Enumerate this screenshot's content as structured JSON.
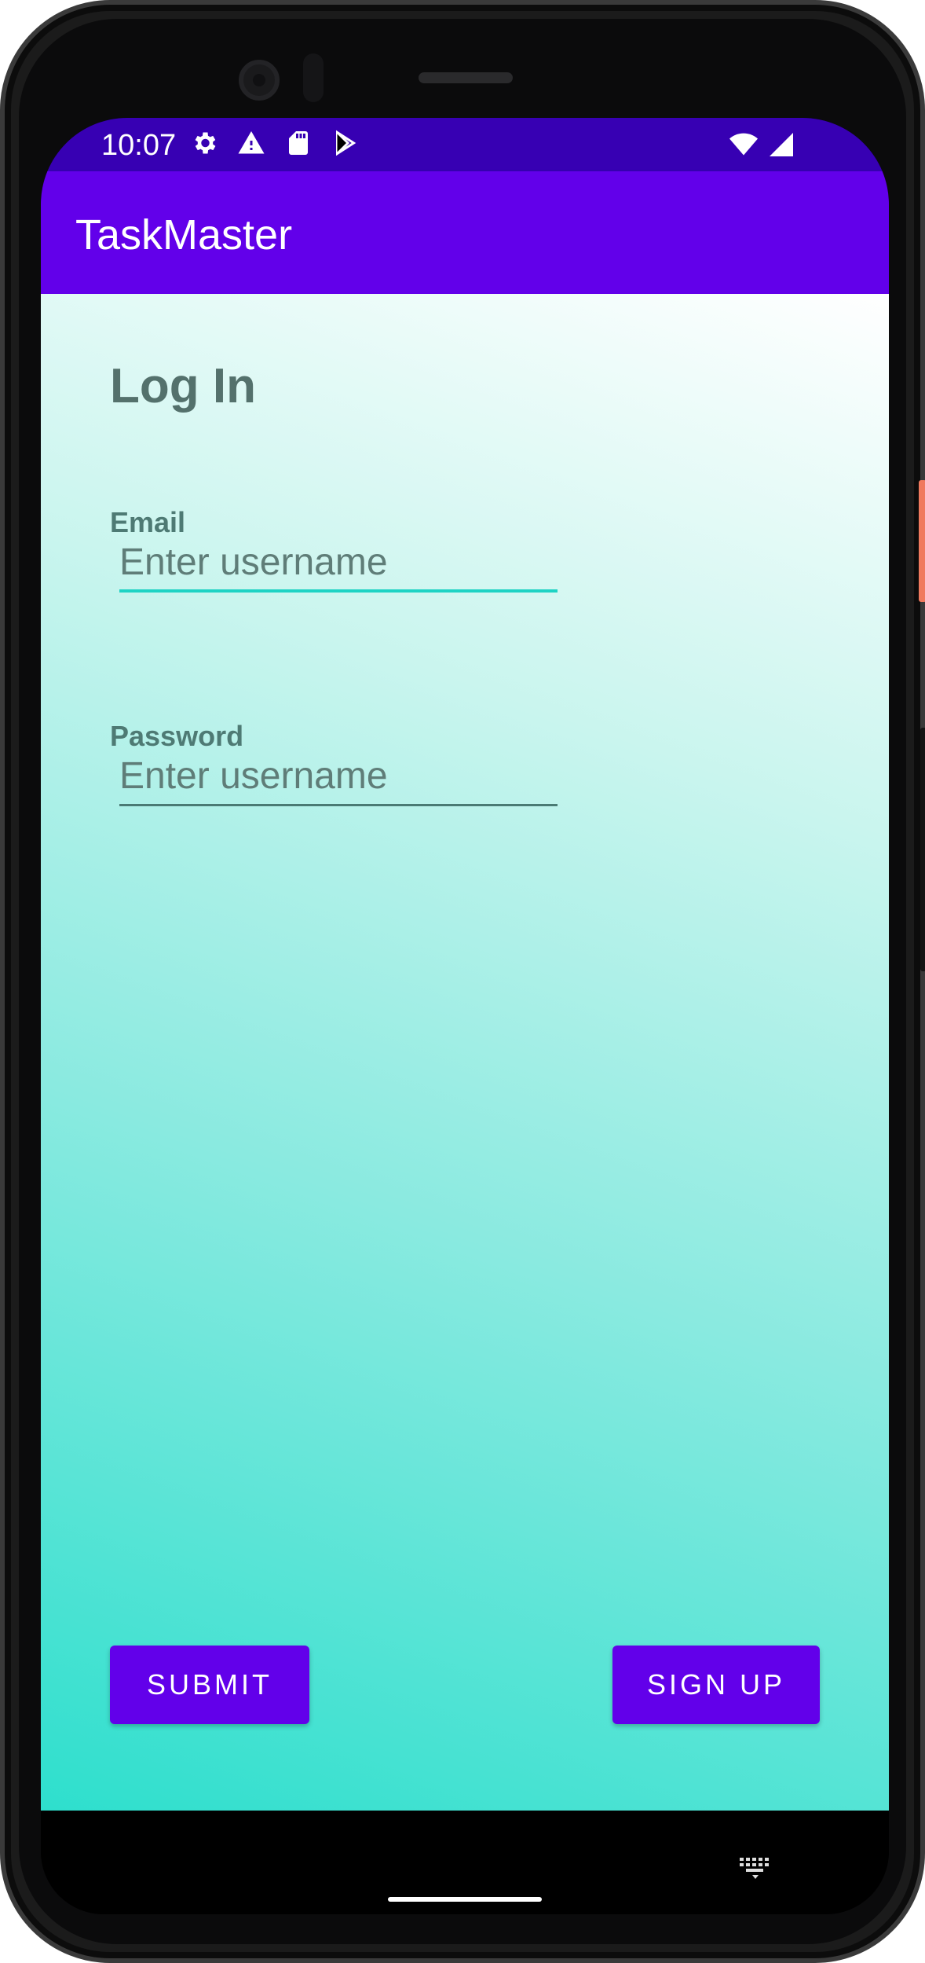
{
  "status_bar": {
    "time": "10:07",
    "left_icons": [
      "settings-icon",
      "warning-icon",
      "sd-card-icon",
      "play-store-icon"
    ],
    "right_icons": [
      "wifi-icon",
      "signal-icon"
    ]
  },
  "app_bar": {
    "title": "TaskMaster"
  },
  "login": {
    "heading": "Log In",
    "email_label": "Email",
    "email_placeholder": "Enter username",
    "password_label": "Password",
    "password_placeholder": "Enter username",
    "submit_label": "SUBMIT",
    "signup_label": "SIGN UP"
  },
  "colors": {
    "status_bar": "#3700b3",
    "app_bar": "#6200ea",
    "button": "#6200ea",
    "focus_underline": "#1ed3c4"
  },
  "nav_bar": {
    "icons": [
      "keyboard-icon",
      "home-gesture-pill"
    ]
  }
}
